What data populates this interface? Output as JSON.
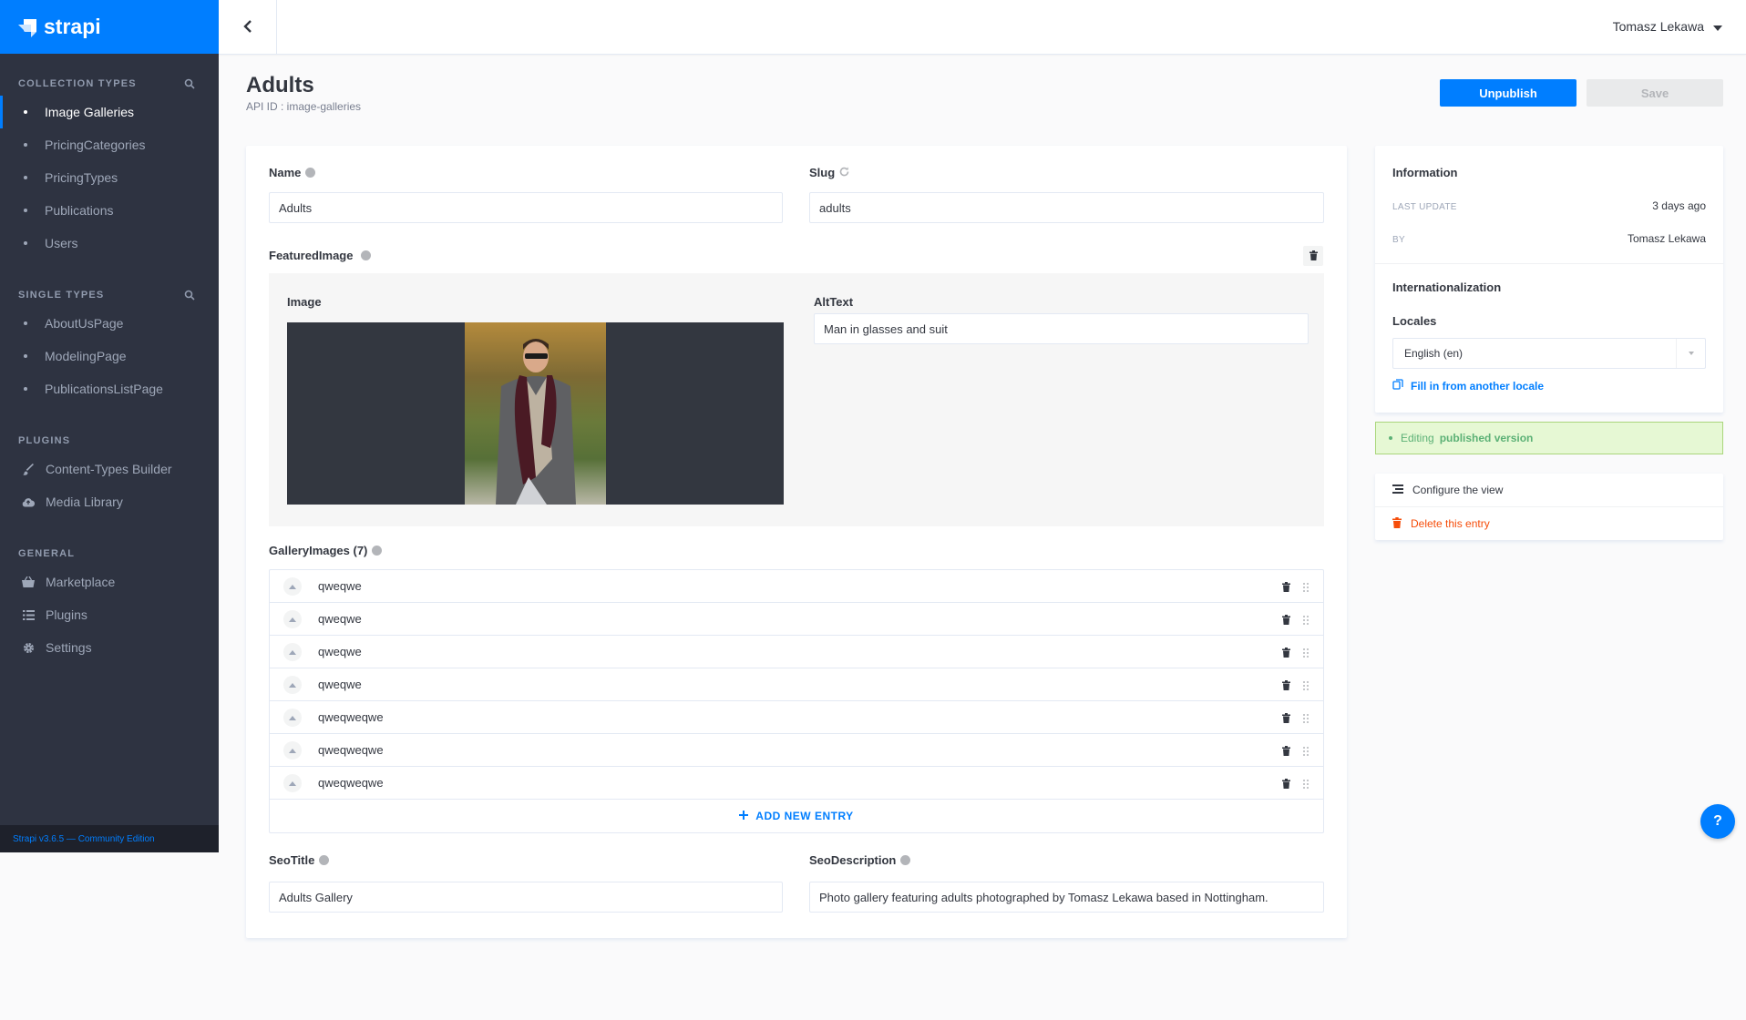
{
  "brand": {
    "name": "strapi"
  },
  "sidebar": {
    "collection_heading": "COLLECTION TYPES",
    "collection_items": [
      {
        "label": "Image Galleries",
        "active": true
      },
      {
        "label": "PricingCategories"
      },
      {
        "label": "PricingTypes"
      },
      {
        "label": "Publications"
      },
      {
        "label": "Users"
      }
    ],
    "single_heading": "SINGLE TYPES",
    "single_items": [
      {
        "label": "AboutUsPage"
      },
      {
        "label": "ModelingPage"
      },
      {
        "label": "PublicationsListPage"
      }
    ],
    "plugins_heading": "PLUGINS",
    "plugin_items": [
      {
        "label": "Content-Types Builder",
        "icon": "brush-icon"
      },
      {
        "label": "Media Library",
        "icon": "cloud-icon"
      }
    ],
    "general_heading": "GENERAL",
    "general_items": [
      {
        "label": "Marketplace",
        "icon": "basket-icon"
      },
      {
        "label": "Plugins",
        "icon": "list-icon"
      },
      {
        "label": "Settings",
        "icon": "gear-icon"
      }
    ],
    "version": "Strapi v3.6.5 — Community Edition"
  },
  "header": {
    "user_name": "Tomasz Lekawa"
  },
  "page": {
    "title": "Adults",
    "api_id": "API ID : image-galleries",
    "publish_label": "Unpublish",
    "save_label": "Save"
  },
  "form": {
    "name_label": "Name",
    "name_value": "Adults",
    "slug_label": "Slug",
    "slug_value": "adults",
    "featured_label": "FeaturedImage",
    "image_label": "Image",
    "alt_label": "AltText",
    "alt_value": "Man in glasses and suit",
    "gallery_label": "GalleryImages (7)",
    "gallery_items": [
      "qweqwe",
      "qweqwe",
      "qweqwe",
      "qweqwe",
      "qweqweqwe",
      "qweqweqwe",
      "qweqweqwe"
    ],
    "add_entry_label": "ADD NEW ENTRY",
    "seo_title_label": "SeoTitle",
    "seo_title_value": "Adults Gallery",
    "seo_desc_label": "SeoDescription",
    "seo_desc_value": "Photo gallery featuring adults photographed by Tomasz Lekawa based in Nottingham."
  },
  "info_panel": {
    "title": "Information",
    "last_update_label": "LAST UPDATE",
    "last_update_value": "3 days ago",
    "by_label": "BY",
    "by_value": "Tomasz Lekawa",
    "i18n_title": "Internationalization",
    "locales_label": "Locales",
    "locale_value": "English (en)",
    "fill_link": "Fill in from another locale"
  },
  "status": {
    "prefix": "Editing",
    "bold": "published version"
  },
  "actions": {
    "configure": "Configure the view",
    "delete": "Delete this entry"
  },
  "help": {
    "label": "?"
  },
  "colors": {
    "accent": "#007eff",
    "sidebar": "#2e3341",
    "danger": "#f64d0a",
    "success_bg": "#e6f8d4"
  }
}
